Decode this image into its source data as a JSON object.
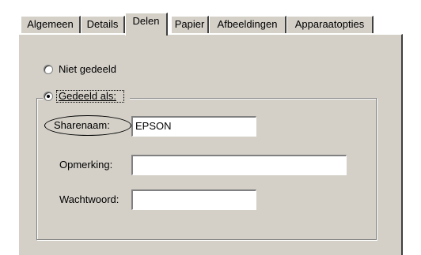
{
  "tabs": [
    {
      "label": "Algemeen"
    },
    {
      "label": "Details"
    },
    {
      "label": "Delen"
    },
    {
      "label": "Papier"
    },
    {
      "label": "Afbeeldingen"
    },
    {
      "label": "Apparaatopties"
    }
  ],
  "active_tab": "Delen",
  "sharing": {
    "not_shared_label": "Niet gedeeld",
    "not_shared_selected": false,
    "shared_as_label": "Gedeeld als:",
    "shared_as_selected": true
  },
  "fields": {
    "share_name": {
      "label": "Sharenaam:",
      "value": "EPSON"
    },
    "comment": {
      "label": "Opmerking:",
      "value": ""
    },
    "password": {
      "label": "Wachtwoord:",
      "value": ""
    }
  }
}
